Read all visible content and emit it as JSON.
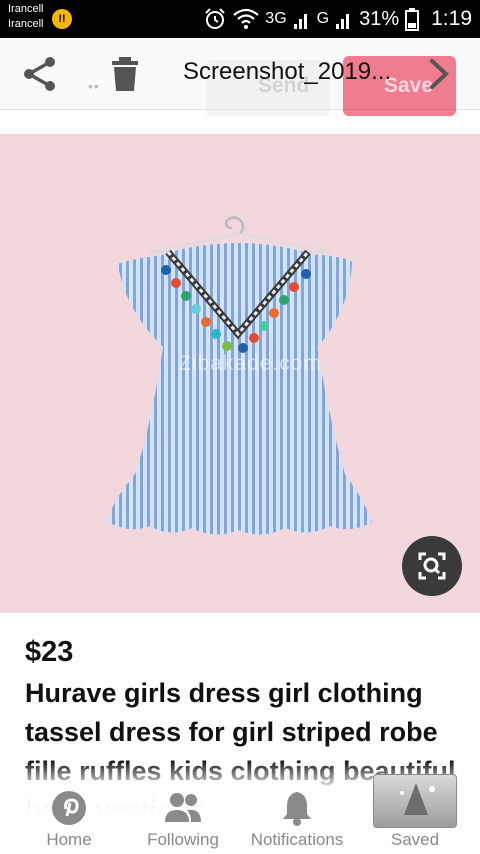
{
  "status_bar": {
    "carrier_1": "Irancell",
    "carrier_2": "Irancell",
    "notification_badge": "!!",
    "network_1": "3G",
    "network_2": "G",
    "battery_percent": "31%",
    "time": "1:19",
    "icons": [
      "alarm-icon",
      "wifi-icon",
      "signal-icon",
      "battery-icon"
    ]
  },
  "toolbar": {
    "title": "Screenshot_2019...",
    "send_label": "Send",
    "save_label": "Save",
    "icons": [
      "share-icon",
      "trash-icon",
      "chevron-right-icon"
    ]
  },
  "product": {
    "watermark": "Zibakade.com",
    "price": "$23",
    "description": "Hurave girls dress girl clothing tassel dress for girl striped robe fille ruffles kids clothing beautiful baby vestidos"
  },
  "bottom_nav": {
    "items": [
      {
        "label": "Home",
        "icon": "pinterest-icon"
      },
      {
        "label": "Following",
        "icon": "people-icon"
      },
      {
        "label": "Notifications",
        "icon": "bell-icon"
      },
      {
        "label": "Saved",
        "icon": "saved-icon"
      }
    ]
  },
  "colors": {
    "accent": "#e60023",
    "image_background": "#f2d7dd",
    "dress_blue": "#7fa7dc"
  }
}
